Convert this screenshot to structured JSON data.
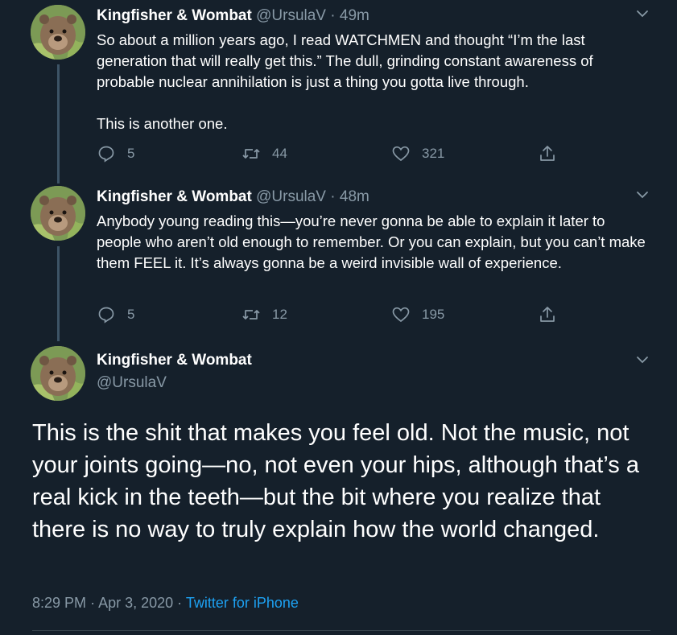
{
  "colors": {
    "background": "#15202b",
    "secondary_text": "#8899a6",
    "link": "#1da1f2",
    "thread_line": "#3d5466"
  },
  "tweets": [
    {
      "name": "Kingfisher & Wombat",
      "handle": "@UrsulaV",
      "separator": "·",
      "time": "49m",
      "paragraphs": [
        "So about a million years ago, I read WATCHMEN and thought “I’m the last generation that will really get this.” The dull, grinding constant awareness of probable nuclear annihilation is just a thing you gotta live through.",
        "This is another one."
      ],
      "replies": "5",
      "retweets": "44",
      "likes": "321"
    },
    {
      "name": "Kingfisher & Wombat",
      "handle": "@UrsulaV",
      "separator": "·",
      "time": "48m",
      "paragraphs": [
        "Anybody young reading this—you’re never gonna be able to explain it later to people who aren’t old enough to remember. Or you can explain, but you can’t make them FEEL it. It’s always gonna be a weird invisible wall of experience."
      ],
      "replies": "5",
      "retweets": "12",
      "likes": "195"
    }
  ],
  "main_tweet": {
    "name": "Kingfisher & Wombat",
    "handle": "@UrsulaV",
    "text": "This is the shit that makes you feel old. Not the music, not your joints going—no, not even your hips, although that’s a real kick in the teeth—but the bit where you realize that there is no way to truly explain how the world changed.",
    "time": "8:29 PM",
    "separator": "·",
    "date": "Apr 3, 2020",
    "separator2": "·",
    "source": "Twitter for iPhone"
  },
  "icons": {
    "reply": "reply-icon",
    "retweet": "retweet-icon",
    "like": "heart-icon",
    "share": "share-icon",
    "more": "chevron-down-icon",
    "avatar": "wombat-avatar"
  }
}
